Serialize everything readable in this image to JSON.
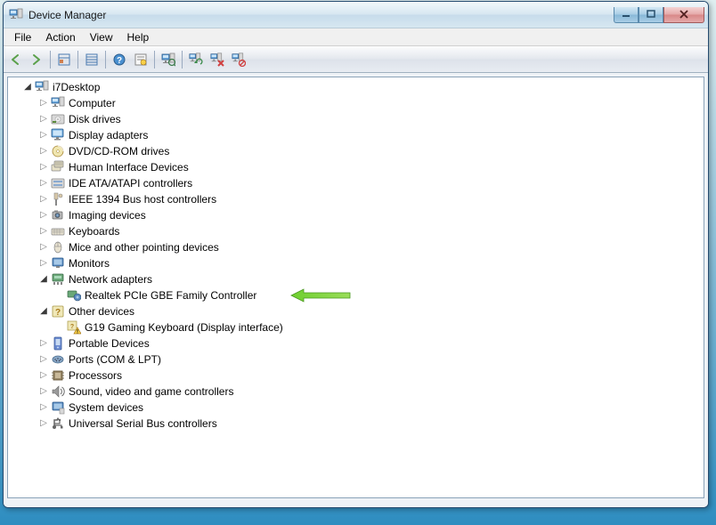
{
  "window": {
    "title": "Device Manager"
  },
  "menu": {
    "file": "File",
    "action": "Action",
    "view": "View",
    "help": "Help"
  },
  "toolbar": {
    "back": "Back",
    "forward": "Forward",
    "show_hidden": "Show hidden devices",
    "properties": "Properties",
    "help": "Help",
    "refresh": "Refresh",
    "update_driver": "Update driver",
    "uninstall": "Uninstall",
    "disable": "Disable",
    "scan_hardware": "Scan for hardware changes"
  },
  "tree": {
    "root": "i7Desktop",
    "nodes": {
      "computer": "Computer",
      "disk_drives": "Disk drives",
      "display_adapters": "Display adapters",
      "dvd_cdrom": "DVD/CD-ROM drives",
      "hid": "Human Interface Devices",
      "ide_atapi": "IDE ATA/ATAPI controllers",
      "ieee1394": "IEEE 1394 Bus host controllers",
      "imaging": "Imaging devices",
      "keyboards": "Keyboards",
      "mice": "Mice and other pointing devices",
      "monitors": "Monitors",
      "network_adapters": "Network adapters",
      "network_realtek": "Realtek PCIe GBE Family Controller",
      "other_devices": "Other devices",
      "other_g19": "G19 Gaming Keyboard (Display interface)",
      "portable": "Portable Devices",
      "ports": "Ports (COM & LPT)",
      "processors": "Processors",
      "sound": "Sound, video and game controllers",
      "system": "System devices",
      "usb": "Universal Serial Bus controllers"
    }
  }
}
